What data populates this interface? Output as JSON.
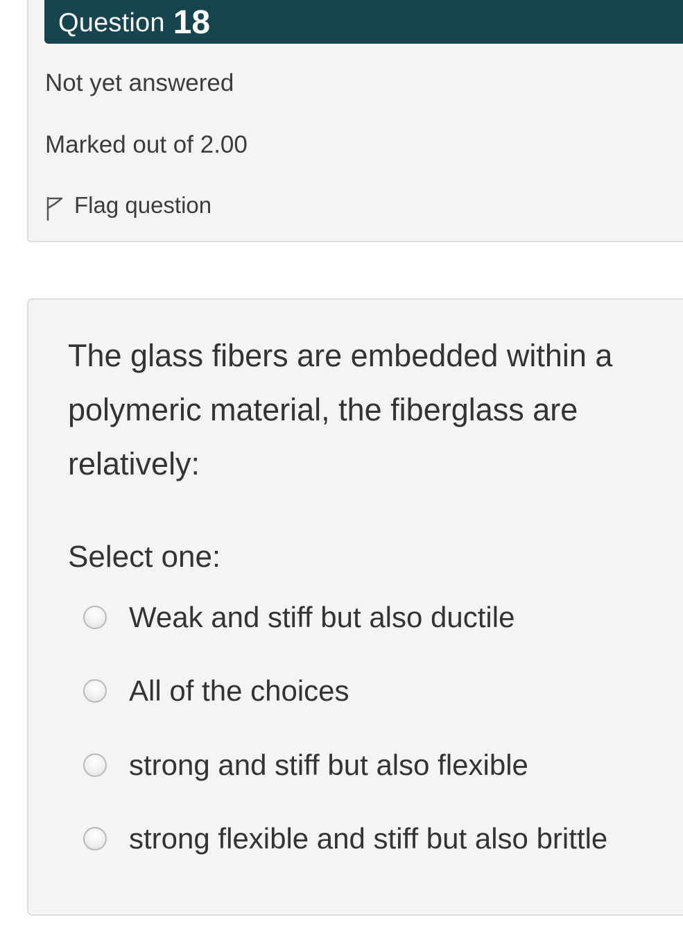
{
  "question": {
    "label": "Question",
    "number": "18",
    "state": "Not yet answered",
    "grade": "Marked out of 2.00",
    "flag_label": "Flag question",
    "text": "The glass fibers are embedded within a polymeric material, the fiberglass are relatively:",
    "prompt": "Select one:",
    "answers": [
      {
        "label": "Weak and stiff but also ductile"
      },
      {
        "label": "All of the choices"
      },
      {
        "label": "strong and stiff but also flexible"
      },
      {
        "label": "strong flexible and stiff but also brittle"
      }
    ]
  },
  "colors": {
    "header_bg": "#16444f",
    "card_bg": "#f4f4f4",
    "text": "#333333"
  },
  "icons": {
    "flag": "flag-outline-icon",
    "radio": "radio-unchecked-icon"
  }
}
